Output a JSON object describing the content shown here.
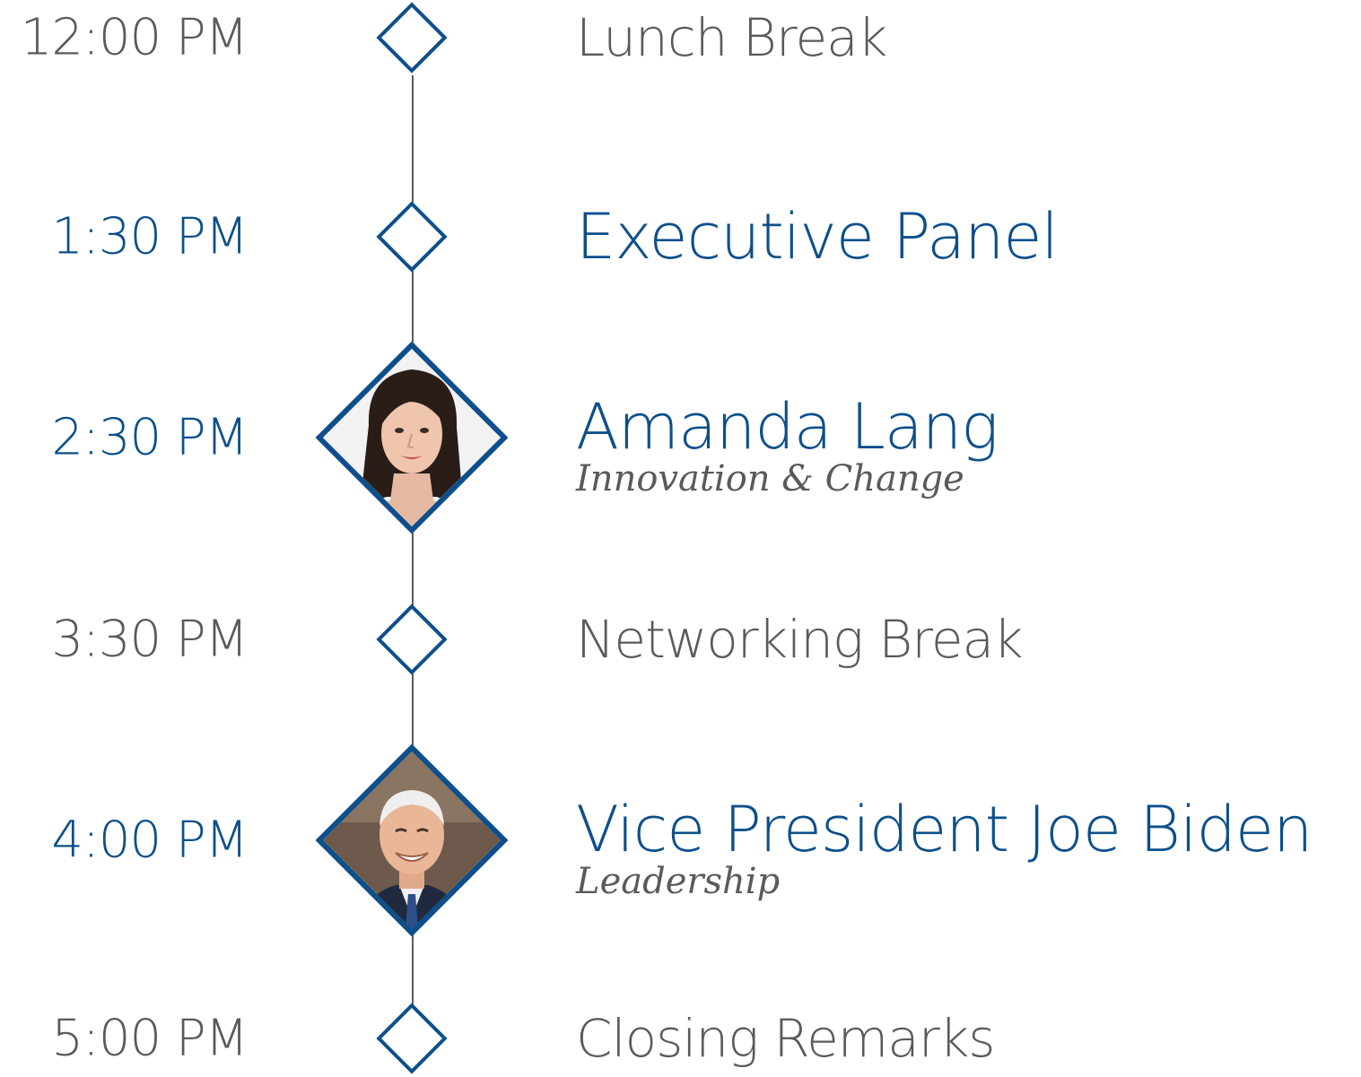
{
  "colors": {
    "accent": "#0d4f8b",
    "muted": "#5a5a5a",
    "line": "#5a5a5a"
  },
  "schedule": [
    {
      "time": "12:00 PM",
      "title": "Lunch Break",
      "kind": "break"
    },
    {
      "time": "1:30 PM",
      "title": "Executive Panel",
      "kind": "session"
    },
    {
      "time": "2:30 PM",
      "title": "Amanda Lang",
      "subtitle": "Innovation & Change",
      "kind": "speaker",
      "icon": "speaker-portrait-woman"
    },
    {
      "time": "3:30 PM",
      "title": "Networking Break",
      "kind": "break"
    },
    {
      "time": "4:00 PM",
      "title": "Vice President Joe Biden",
      "subtitle": "Leadership",
      "kind": "speaker",
      "icon": "speaker-portrait-man"
    },
    {
      "time": "5:00 PM",
      "title": "Closing Remarks",
      "kind": "break"
    }
  ]
}
